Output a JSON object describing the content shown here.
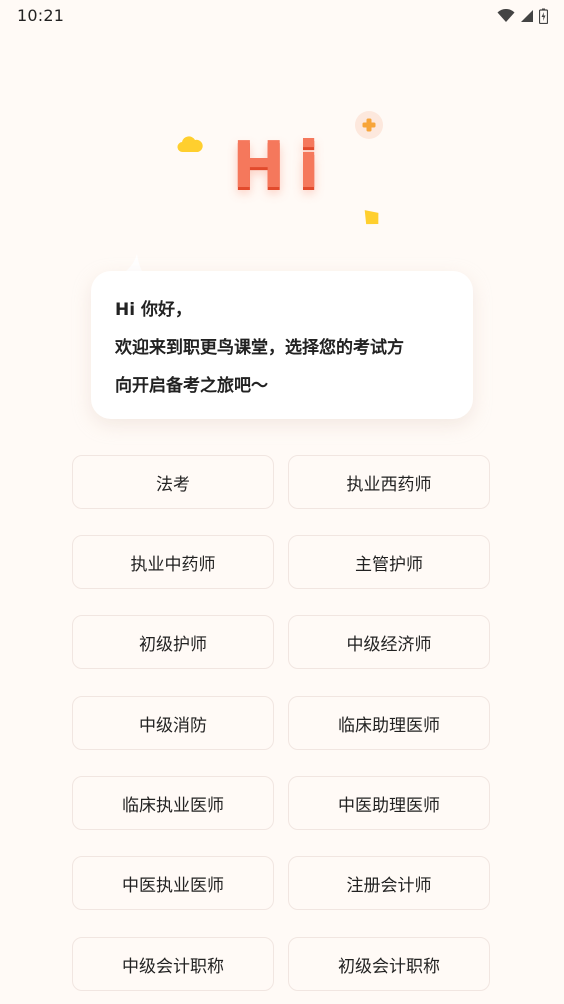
{
  "status_bar": {
    "time": "10:21"
  },
  "hero": {
    "greeting_art": "Hi"
  },
  "bubble": {
    "line1": "Hi 你好，",
    "line2": "欢迎来到职更鸟课堂，选择您的考试方",
    "line3": "向开启备考之旅吧～"
  },
  "exams": [
    "法考",
    "执业西药师",
    "执业中药师",
    "主管护师",
    "初级护师",
    "中级经济师",
    "中级消防",
    "临床助理医师",
    "临床执业医师",
    "中医助理医师",
    "中医执业医师",
    "注册会计师",
    "中级会计职称",
    "初级会计职称"
  ],
  "colors": {
    "background": "#fffaf6",
    "accent": "#f5785c",
    "button_border": "#f1e6e1",
    "cloud_yellow": "#ffcf2e"
  }
}
